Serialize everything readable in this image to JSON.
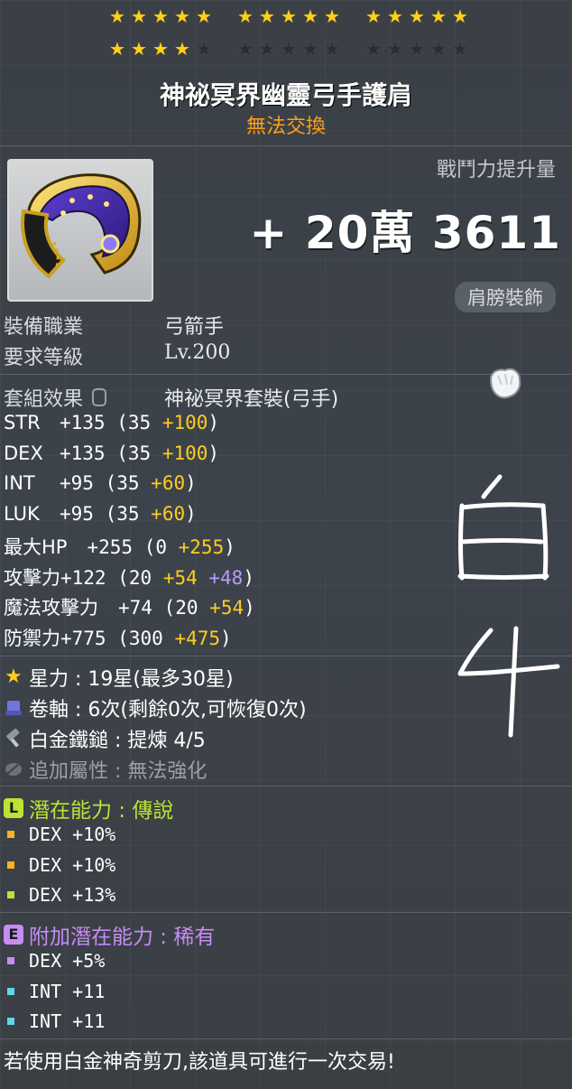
{
  "stars": {
    "row1": [
      5,
      5,
      5
    ],
    "row2_filled": 4,
    "group_size": 5,
    "star_force_current": 19,
    "star_force_max": 30
  },
  "item": {
    "name": "神祕冥界幽靈弓手護肩",
    "trade_status": "無法交換",
    "combat_power_label": "戰鬥力提升量",
    "combat_power_value": "+ 20萬 3611",
    "category": "肩膀裝飾"
  },
  "requirements": {
    "job_label": "裝備職業",
    "job_value": "弓箭手",
    "level_label": "要求等級",
    "level_value": "Lv.200",
    "set_label": "套組效果",
    "set_value": "神祕冥界套裝(弓手)"
  },
  "stats": [
    {
      "name": "STR",
      "total": "+135",
      "base": "(35 ",
      "bonus": "+100",
      "extra": "",
      "close": ")"
    },
    {
      "name": "DEX",
      "total": "+135",
      "base": "(35 ",
      "bonus": "+100",
      "extra": "",
      "close": ")"
    },
    {
      "name": "INT",
      "total": "+95",
      "base": "(35 ",
      "bonus": "+60",
      "extra": "",
      "close": ")"
    },
    {
      "name": "LUK",
      "total": "+95",
      "base": "(35 ",
      "bonus": "+60",
      "extra": "",
      "close": ")"
    },
    {
      "name": "最大HP",
      "total": "+255",
      "base": "(0 ",
      "bonus": "+255",
      "extra": "",
      "close": ")"
    },
    {
      "name": "攻擊力",
      "total": "+122",
      "base": "(20 ",
      "bonus": "+54",
      "extra": " +48",
      "close": ")"
    },
    {
      "name": "魔法攻擊力",
      "total": "+74",
      "base": "(20 ",
      "bonus": "+54",
      "extra": "",
      "close": ")"
    },
    {
      "name": "防禦力",
      "total": "+775",
      "base": "(300 ",
      "bonus": "+475",
      "extra": "",
      "close": ")"
    }
  ],
  "info": {
    "starforce": "星力 : 19星(最多30星)",
    "scroll": "卷軸 : 6次(剩餘0次,可恢復0次)",
    "platinum": "白金鐵鎚 : 提煉 4/5",
    "additional": "追加屬性 : 無法強化"
  },
  "potential": {
    "label": "潛在能力 : 傳說",
    "badge": "L",
    "color": "#bde334",
    "lines": [
      {
        "text": "DEX +10%",
        "bullet_color": "#f7b51c"
      },
      {
        "text": "DEX +10%",
        "bullet_color": "#f7b51c"
      },
      {
        "text": "DEX +13%",
        "bullet_color": "#bde334"
      }
    ]
  },
  "bonus_potential": {
    "label": "附加潛在能力 : 稀有",
    "badge": "E",
    "color": "#c78bf5",
    "lines": [
      {
        "text": "DEX +5%",
        "bullet_color": "#c78bf5"
      },
      {
        "text": "INT +11",
        "bullet_color": "#5fd7e8"
      },
      {
        "text": "INT +11",
        "bullet_color": "#5fd7e8"
      }
    ]
  },
  "footer": {
    "note": "若使用白金神奇剪刀,該道具可進行一次交易!"
  },
  "handwriting": {
    "line1": "白",
    "line2": "4"
  },
  "colors": {
    "trade_status": "#ff9d1c",
    "bonus_yellow": "#ffcc22",
    "bonus_purple": "#b39dff",
    "background": "#3b4148"
  }
}
